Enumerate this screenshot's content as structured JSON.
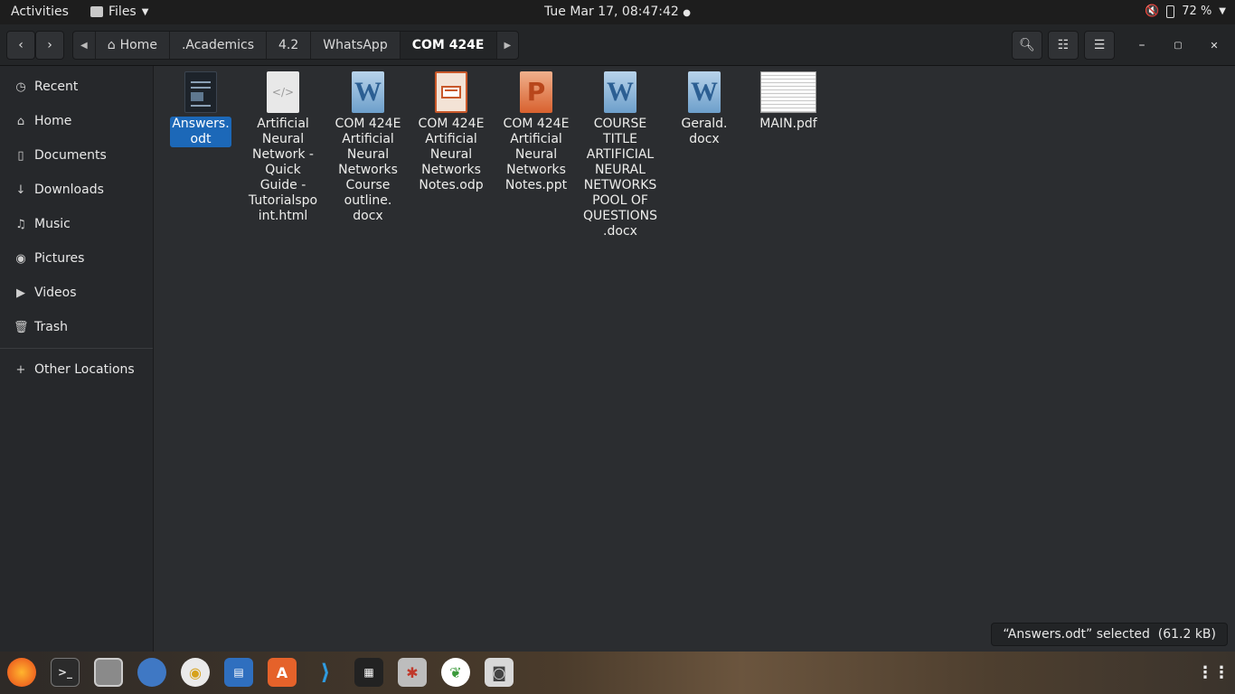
{
  "topbar": {
    "activities": "Activities",
    "app_name": "Files",
    "clock": "Tue Mar 17, 08:47:42",
    "battery": "72 %"
  },
  "header": {
    "breadcrumbs": [
      ".Academics",
      "4.2",
      "WhatsApp",
      "COM 424E"
    ],
    "home_label": "Home"
  },
  "sidebar": {
    "items": [
      {
        "label": "Recent",
        "icon": "clock-icon"
      },
      {
        "label": "Home",
        "icon": "home-icon"
      },
      {
        "label": "Documents",
        "icon": "document-icon"
      },
      {
        "label": "Downloads",
        "icon": "download-icon"
      },
      {
        "label": "Music",
        "icon": "music-icon"
      },
      {
        "label": "Pictures",
        "icon": "camera-icon"
      },
      {
        "label": "Videos",
        "icon": "video-icon"
      },
      {
        "label": "Trash",
        "icon": "trash-icon"
      }
    ],
    "other_locations": "Other Locations"
  },
  "files": [
    {
      "name": "Answers.\nodt",
      "type": "odt",
      "selected": true
    },
    {
      "name": "Artificial\nNeural\nNetwork -\nQuick\nGuide -\nTutorialspo\nint.html",
      "type": "html",
      "selected": false
    },
    {
      "name": "COM 424E\nArtificial\nNeural\nNetworks\nCourse\noutline.\ndocx",
      "type": "docx",
      "selected": false
    },
    {
      "name": "COM 424E\nArtificial\nNeural\nNetworks\nNotes.odp",
      "type": "odp",
      "selected": false
    },
    {
      "name": "COM 424E\nArtificial\nNeural\nNetworks\nNotes.ppt",
      "type": "ppt",
      "selected": false
    },
    {
      "name": "COURSE\nTITLE\nARTIFICIAL\nNEURAL\nNETWORKS\nPOOL OF\nQUESTIONS\n.docx",
      "type": "docx",
      "selected": false
    },
    {
      "name": "Gerald.\ndocx",
      "type": "docx",
      "selected": false
    },
    {
      "name": "MAIN.pdf",
      "type": "pdf",
      "selected": false
    }
  ],
  "status": "“Answers.odt” selected  (61.2 kB)",
  "dock": [
    "firefox-icon",
    "terminal-icon",
    "files-icon",
    "thunderbird-icon",
    "rhythmbox-icon",
    "writer-icon",
    "software-icon",
    "vscode-icon",
    "video-editor-icon",
    "settings-icon",
    "mongodb-icon",
    "screenshot-icon"
  ]
}
